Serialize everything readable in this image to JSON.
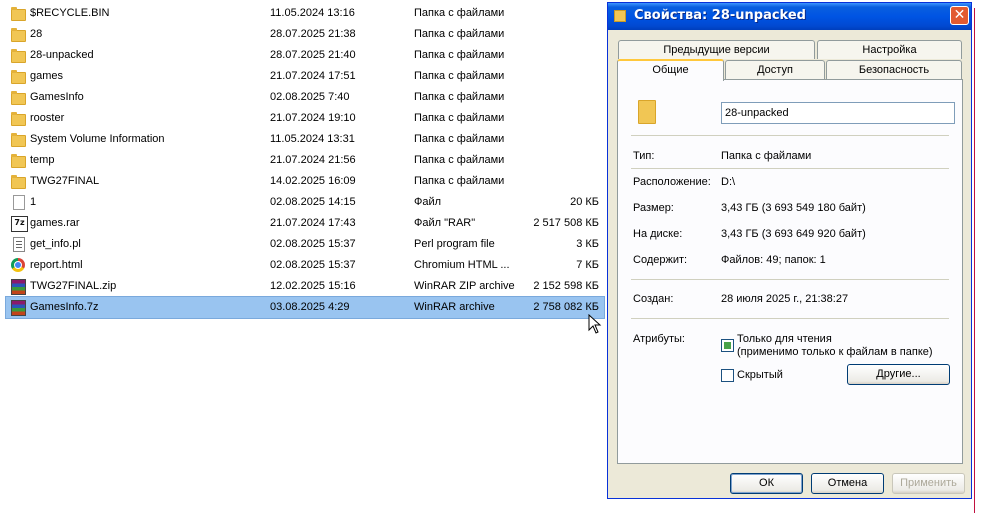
{
  "files": [
    {
      "name": "$RECYCLE.BIN",
      "date": "11.05.2024 13:16",
      "type": "Папка с файлами",
      "size": "",
      "icon": "folder-icon"
    },
    {
      "name": "28",
      "date": "28.07.2025 21:38",
      "type": "Папка с файлами",
      "size": "",
      "icon": "folder-icon"
    },
    {
      "name": "28-unpacked",
      "date": "28.07.2025 21:40",
      "type": "Папка с файлами",
      "size": "",
      "icon": "folder-icon"
    },
    {
      "name": "games",
      "date": "21.07.2024 17:51",
      "type": "Папка с файлами",
      "size": "",
      "icon": "folder-icon"
    },
    {
      "name": "GamesInfo",
      "date": "02.08.2025 7:40",
      "type": "Папка с файлами",
      "size": "",
      "icon": "folder-icon"
    },
    {
      "name": "rooster",
      "date": "21.07.2024 19:10",
      "type": "Папка с файлами",
      "size": "",
      "icon": "folder-icon"
    },
    {
      "name": "System Volume Information",
      "date": "11.05.2024 13:31",
      "type": "Папка с файлами",
      "size": "",
      "icon": "folder-icon"
    },
    {
      "name": "temp",
      "date": "21.07.2024 21:56",
      "type": "Папка с файлами",
      "size": "",
      "icon": "folder-icon"
    },
    {
      "name": "TWG27FINAL",
      "date": "14.02.2025 16:09",
      "type": "Папка с файлами",
      "size": "",
      "icon": "folder-icon"
    },
    {
      "name": "1",
      "date": "02.08.2025 14:15",
      "type": "Файл",
      "size": "20 КБ",
      "icon": "blank-file-icon"
    },
    {
      "name": "games.rar",
      "date": "21.07.2024 17:43",
      "type": "Файл \"RAR\"",
      "size": "2 517 508 КБ",
      "icon": "7z-icon"
    },
    {
      "name": "get_info.pl",
      "date": "02.08.2025 15:37",
      "type": "Perl program file",
      "size": "3 КБ",
      "icon": "text-file-icon"
    },
    {
      "name": "report.html",
      "date": "02.08.2025 15:37",
      "type": "Chromium HTML ...",
      "size": "7 КБ",
      "icon": "chrome-icon"
    },
    {
      "name": "TWG27FINAL.zip",
      "date": "12.02.2025 15:16",
      "type": "WinRAR ZIP archive",
      "size": "2 152 598 КБ",
      "icon": "winrar-icon"
    },
    {
      "name": "GamesInfo.7z",
      "date": "03.08.2025 4:29",
      "type": "WinRAR archive",
      "size": "2 758 082 КБ",
      "icon": "winrar-icon",
      "selected": true
    }
  ],
  "dialog": {
    "title": "Свойства: 28-unpacked",
    "close_glyph": "✕",
    "tabs_back": [
      "Предыдущие версии",
      "Настройка"
    ],
    "tabs_front": [
      "Общие",
      "Доступ",
      "Безопасность"
    ],
    "name_value": "28-unpacked",
    "type_label": "Тип:",
    "type_value": "Папка с файлами",
    "location_label": "Расположение:",
    "location_value": "D:\\",
    "size_label": "Размер:",
    "size_value": "3,43 ГБ (3 693 549 180 байт)",
    "disk_label": "На диске:",
    "disk_value": "3,43 ГБ (3 693 649 920 байт)",
    "contains_label": "Содержит:",
    "contains_value": "Файлов: 49; папок: 1",
    "created_label": "Создан:",
    "created_value": "28 июля 2025 г., 21:38:27",
    "attributes_label": "Атрибуты:",
    "readonly_label": "Только для чтения",
    "readonly_note": "(применимо только к файлам в папке)",
    "readonly_checked": true,
    "hidden_label": "Скрытый",
    "hidden_checked": false,
    "other_button": "Другие...",
    "ok_button": "ОК",
    "cancel_button": "Отмена",
    "apply_button": "Применить"
  }
}
